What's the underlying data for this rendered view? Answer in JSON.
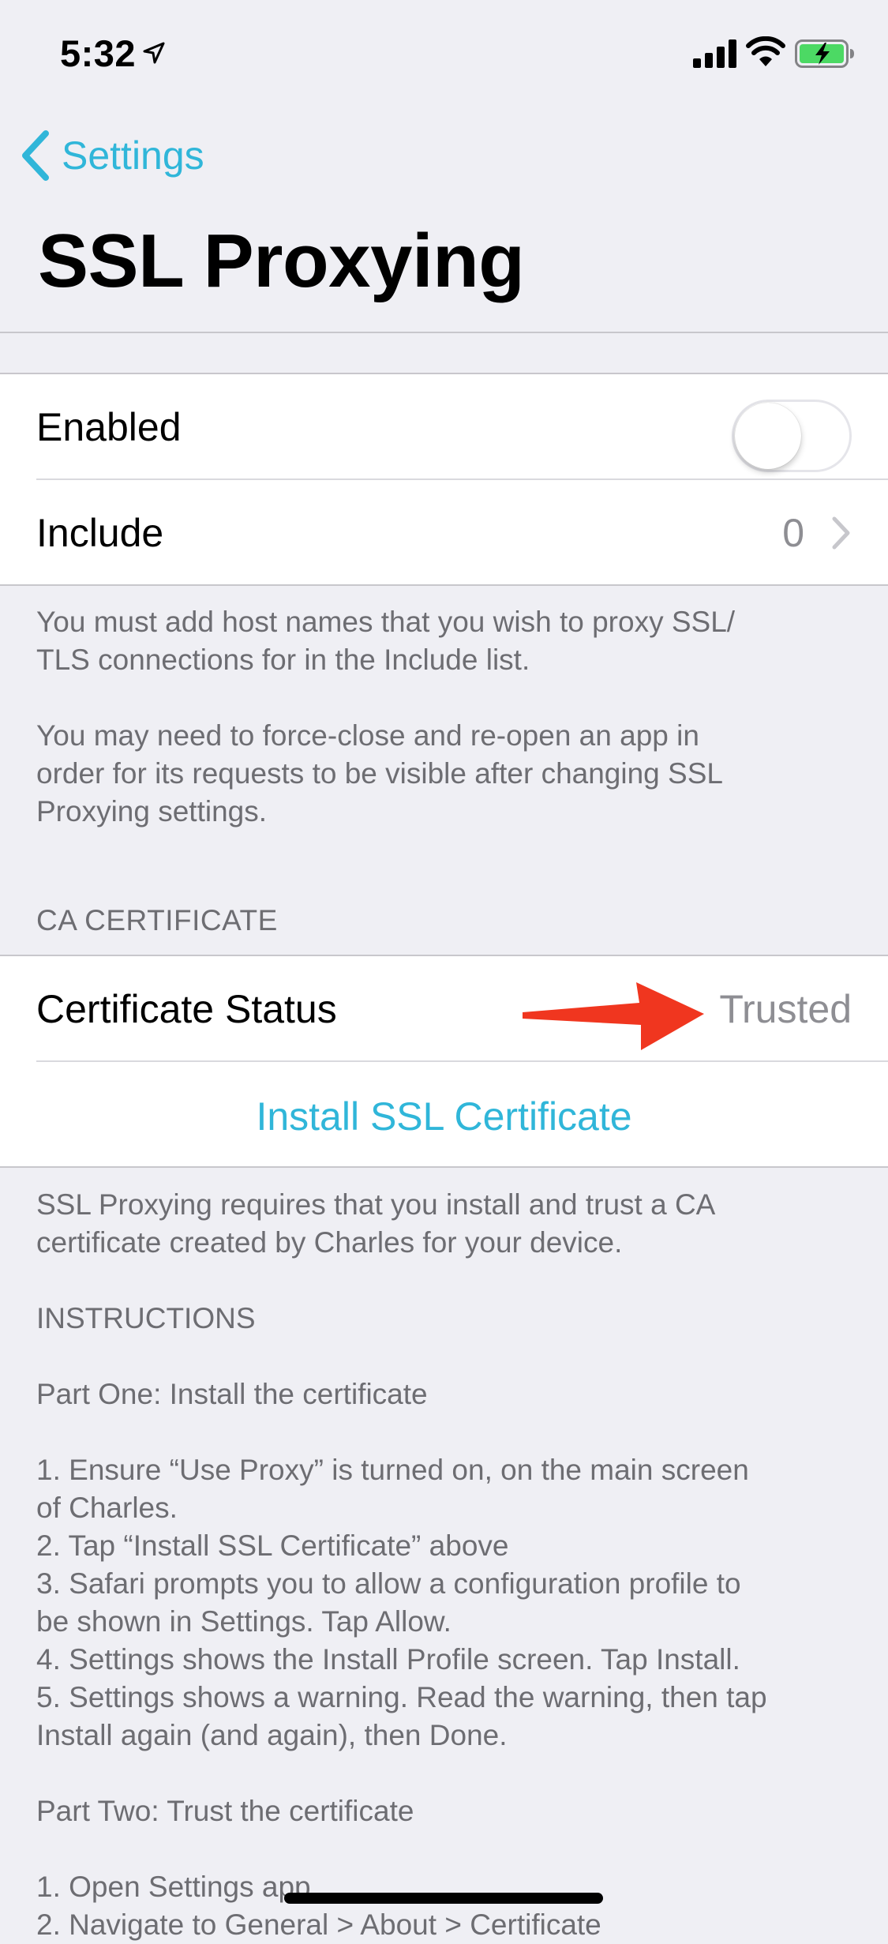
{
  "status_bar": {
    "time": "5:32",
    "icons": [
      "location-arrow-icon",
      "signal-icon",
      "wifi-icon",
      "battery-charging-icon"
    ]
  },
  "nav": {
    "back_label": "Settings",
    "title": "SSL Proxying",
    "accent_color": "#30b6d9"
  },
  "proxy_group": {
    "enabled_label": "Enabled",
    "enabled": false,
    "include_label": "Include",
    "include_count": "0"
  },
  "proxy_footer": "You must add host names that you wish to proxy SSL/\nTLS connections for in the Include list.\n\nYou may need to force-close and re-open an app in\norder for its requests to be visible after changing SSL\nProxying settings.",
  "ca_section": {
    "header": "CA CERTIFICATE",
    "status_label": "Certificate Status",
    "status_value": "Trusted",
    "install_label": "Install SSL Certificate"
  },
  "instructions_footer": "SSL Proxying requires that you install and trust a CA\ncertificate created by Charles for your device.\n\nINSTRUCTIONS\n\nPart One: Install the certificate\n\n1. Ensure “Use Proxy” is turned on, on the main screen\nof Charles.\n2. Tap “Install SSL Certificate” above\n3. Safari prompts you to allow a configuration profile to\nbe shown in Settings. Tap Allow.\n4. Settings shows the Install Profile screen. Tap Install.\n5. Settings shows a warning. Read the warning, then tap\nInstall again (and again), then Done.\n\nPart Two: Trust the certificate\n\n1. Open Settings app\n2. Navigate to General > About > Certificate",
  "annotation_arrow_color": "#f0361f"
}
